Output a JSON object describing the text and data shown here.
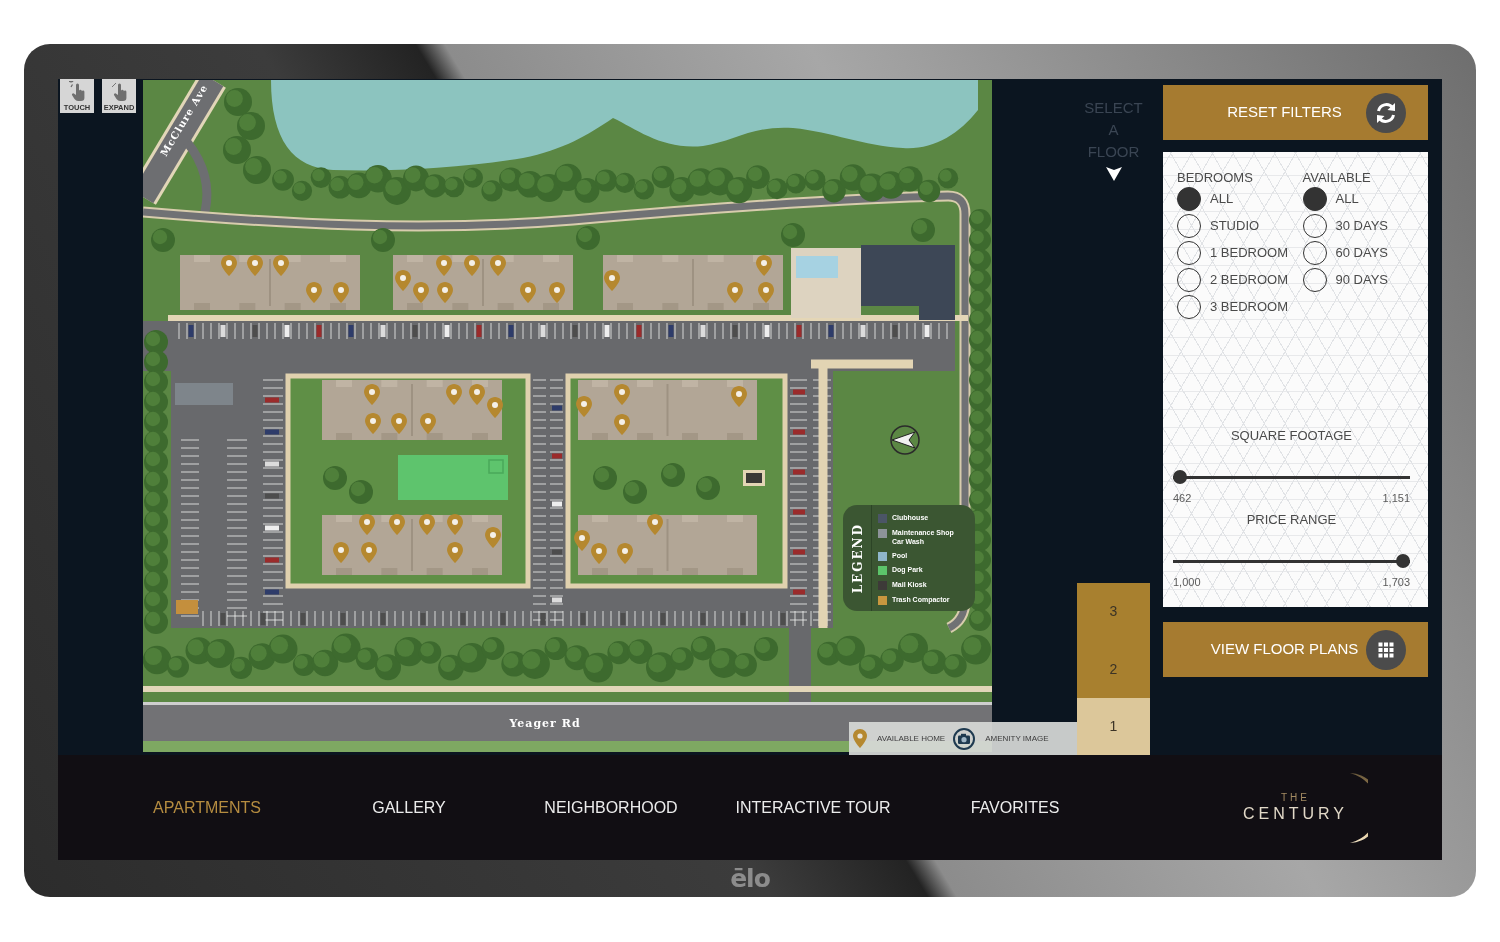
{
  "monitor": {
    "brand": "ēlo"
  },
  "toolbar": [
    {
      "label": "TOUCH",
      "kind": "touch"
    },
    {
      "label": "EXPAND",
      "kind": "expand"
    }
  ],
  "map": {
    "street_labels": [
      {
        "text": "McClure Ave",
        "kind": "diagonal"
      },
      {
        "text": "Yeager Rd",
        "kind": "horizontal"
      }
    ],
    "legend": {
      "title": "LEGEND",
      "items": [
        {
          "label": "Clubhouse",
          "color": "#4b5566"
        },
        {
          "label": "Maintenance Shop Car Wash",
          "color": "#8d9399"
        },
        {
          "label": "Pool",
          "color": "#8fb6cb"
        },
        {
          "label": "Dog Park",
          "color": "#5cc46a"
        },
        {
          "label": "Mail Kiosk",
          "color": "#3d3a38"
        },
        {
          "label": "Trash Compactor",
          "color": "#c8973f"
        }
      ]
    }
  },
  "map_key": [
    {
      "label": "AVAILABLE HOME",
      "kind": "pin"
    },
    {
      "label": "AMENITY IMAGE",
      "kind": "camera"
    }
  ],
  "floor_picker": {
    "prompt": "SELECT A FLOOR",
    "floors": [
      {
        "label": "3",
        "selected": false
      },
      {
        "label": "2",
        "selected": false
      },
      {
        "label": "1",
        "selected": true
      }
    ]
  },
  "filters": {
    "reset_label": "RESET FILTERS",
    "groups": [
      {
        "heading": "BEDROOMS",
        "options": [
          {
            "label": "ALL",
            "selected": true
          },
          {
            "label": "STUDIO",
            "selected": false
          },
          {
            "label": "1 BEDROOM",
            "selected": false
          },
          {
            "label": "2 BEDROOM",
            "selected": false
          },
          {
            "label": "3 BEDROOM",
            "selected": false
          }
        ]
      },
      {
        "heading": "AVAILABLE",
        "options": [
          {
            "label": "ALL",
            "selected": true
          },
          {
            "label": "30 DAYS",
            "selected": false
          },
          {
            "label": "60 DAYS",
            "selected": false
          },
          {
            "label": "90 DAYS",
            "selected": false
          }
        ]
      }
    ],
    "ranges": [
      {
        "label": "SQUARE FOOTAGE",
        "min": "462",
        "max": "1,151",
        "level": 0
      },
      {
        "label": "PRICE RANGE",
        "min": "1,000",
        "max": "1,703",
        "level": 1
      }
    ],
    "submit_label": "VIEW FLOOR PLANS"
  },
  "nav": {
    "items": [
      {
        "label": "APARTMENTS",
        "selected": true
      },
      {
        "label": "GALLERY",
        "selected": false
      },
      {
        "label": "NEIGHBORHOOD",
        "selected": false
      },
      {
        "label": "INTERACTIVE TOUR",
        "selected": false
      },
      {
        "label": "FAVORITES",
        "selected": false
      }
    ],
    "logo": {
      "small": "THE",
      "main": "CENTURY"
    }
  }
}
